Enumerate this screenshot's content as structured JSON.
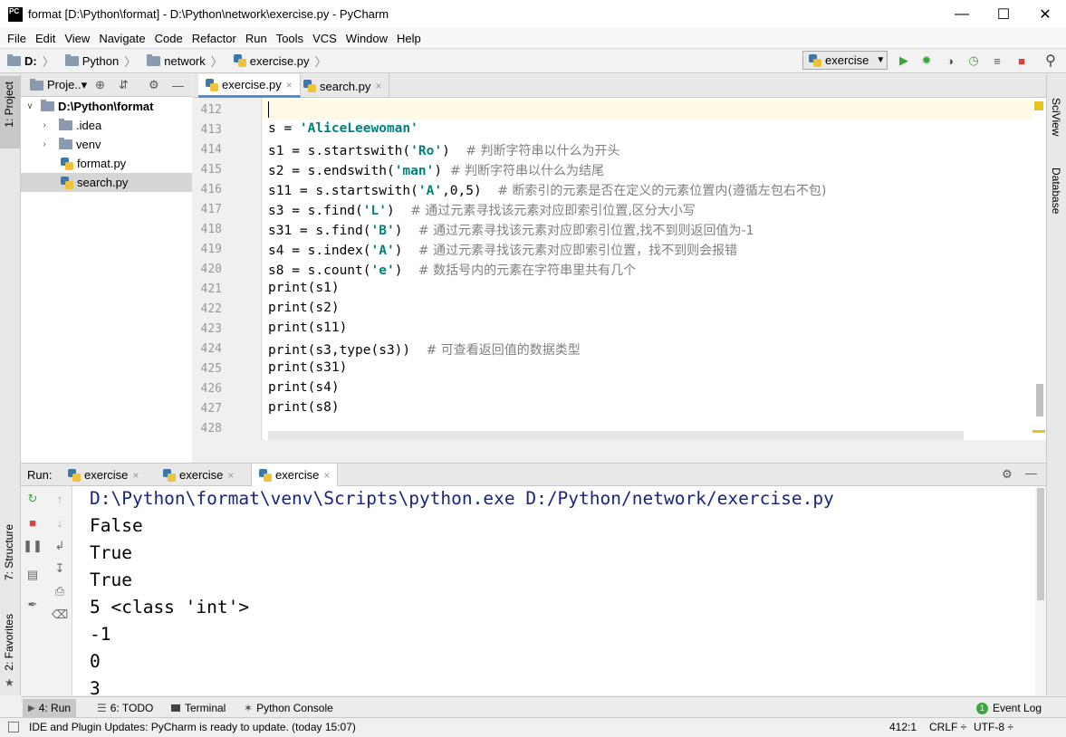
{
  "window": {
    "title": "format [D:\\Python\\format] - D:\\Python\\network\\exercise.py - PyCharm",
    "app_icon_text": "PC"
  },
  "menu": [
    "File",
    "Edit",
    "View",
    "Navigate",
    "Code",
    "Refactor",
    "Run",
    "Tools",
    "VCS",
    "Window",
    "Help"
  ],
  "breadcrumb": [
    "D:",
    "Python",
    "network",
    "exercise.py"
  ],
  "run_config": "exercise",
  "left_tabs": {
    "project": "1: Project",
    "structure": "7: Structure",
    "favorites": "2: Favorites"
  },
  "right_tabs": {
    "sciview": "SciView",
    "database": "Database"
  },
  "project_panel": {
    "title": "Proje..▾",
    "tree": [
      {
        "label": "D:\\Python\\format"
      },
      {
        "label": ".idea"
      },
      {
        "label": "venv"
      },
      {
        "label": "format.py"
      },
      {
        "label": "search.py"
      }
    ]
  },
  "editor": {
    "tabs": [
      {
        "label": "exercise.py",
        "close": "×"
      },
      {
        "label": "search.py",
        "close": "×"
      }
    ],
    "line_numbers": [
      "412",
      "413",
      "414",
      "415",
      "416",
      "417",
      "418",
      "419",
      "420",
      "421",
      "422",
      "423",
      "424",
      "425",
      "426",
      "427",
      "428"
    ],
    "lines": {
      "l413": {
        "code": "s = ",
        "str": "'AliceLeewoman'"
      },
      "l414": {
        "a": "s1 = s.startswith(",
        "str": "'Ro'",
        "b": ")  ",
        "cmt": "# 判断字符串以什么为开头"
      },
      "l415": {
        "a": "s2 = s.endswith(",
        "str": "'man'",
        "b": ") ",
        "cmt": "# 判断字符串以什么为结尾"
      },
      "l416": {
        "a": "s11 = s.startswith(",
        "str": "'A'",
        "b": ",0,5)  ",
        "cmt": "# 断索引的元素是否在定义的元素位置内(遵循左包右不包)"
      },
      "l417": {
        "a": "s3 = s.find(",
        "str": "'L'",
        "b": ")  ",
        "cmt": "# 通过元素寻找该元素对应即索引位置,区分大小写"
      },
      "l418": {
        "a": "s31 = s.find(",
        "str": "'B'",
        "b": ")  ",
        "cmt": "# 通过元素寻找该元素对应即索引位置,找不到则返回值为-1"
      },
      "l419": {
        "a": "s4 = s.index(",
        "str": "'A'",
        "b": ")  ",
        "cmt": "# 通过元素寻找该元素对应即索引位置，找不到则会报错"
      },
      "l420": {
        "a": "s8 = s.count(",
        "str": "'e'",
        "b": ")  ",
        "cmt": "# 数括号内的元素在字符串里共有几个"
      },
      "l421": "print(s1)",
      "l422": "print(s2)",
      "l423": "print(s11)",
      "l424": {
        "a": "print(s3,type(s3))  ",
        "cmt": "# 可查看返回值的数据类型"
      },
      "l425": "print(s31)",
      "l426": "print(s4)",
      "l427": "print(s8)"
    }
  },
  "run_panel": {
    "label": "Run:",
    "tabs": [
      {
        "label": "exercise",
        "close": "×"
      },
      {
        "label": "exercise",
        "close": "×"
      },
      {
        "label": "exercise",
        "close": "×"
      }
    ],
    "output": [
      "D:\\Python\\format\\venv\\Scripts\\python.exe D:/Python/network/exercise.py",
      "False",
      "True",
      "True",
      "5 <class 'int'>",
      "-1",
      "0",
      "3"
    ]
  },
  "bottom_tabs": [
    {
      "label": "4: Run"
    },
    {
      "label": "6: TODO"
    },
    {
      "label": "Terminal"
    },
    {
      "label": "Python Console"
    }
  ],
  "event_log": {
    "count": "1",
    "label": "Event Log"
  },
  "status": {
    "message": "IDE and Plugin Updates: PyCharm is ready to update. (today 15:07)",
    "position": "412:1",
    "line_sep": "CRLF ÷",
    "encoding": "UTF-8 ÷"
  },
  "colors": {
    "accent": "#4e8fd8",
    "string": "#008080",
    "comment": "#808080",
    "run_green": "#3aa73a",
    "stop_red": "#d9423e"
  }
}
